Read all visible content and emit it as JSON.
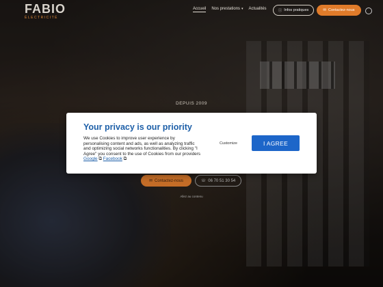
{
  "logo": {
    "word": "FABIO",
    "sub": "ÉLECTRICITÉ"
  },
  "nav": {
    "items": [
      {
        "label": "Accueil",
        "active": true
      },
      {
        "label": "Nos prestations",
        "has_dropdown": true
      },
      {
        "label": "Actualités"
      }
    ],
    "info_button": "Infos pratiques",
    "contact_button": "Contactez-nous"
  },
  "hero": {
    "since": "DEPUIS 2009",
    "contact_button": "Contactez-nous",
    "phone": "06 70 51 30 54",
    "scroll_hint": "Allez au contenu"
  },
  "cookie_modal": {
    "title": "Your privacy is our priority",
    "text": "We use Cookies to improve user experience by personalising content and ads, as well as analyzing traffic and optimizing social networks functionalities. By clicking \"I Agree\" you consent to the use of Cookies from our providers",
    "link_google": "Google",
    "link_facebook": "Facebook",
    "customize_label": "Customize",
    "agree_label": "I AGREE"
  },
  "colors": {
    "accent": "#e07b2a",
    "modal_title": "#1d5fa8",
    "agree_button": "#1d66c9"
  }
}
